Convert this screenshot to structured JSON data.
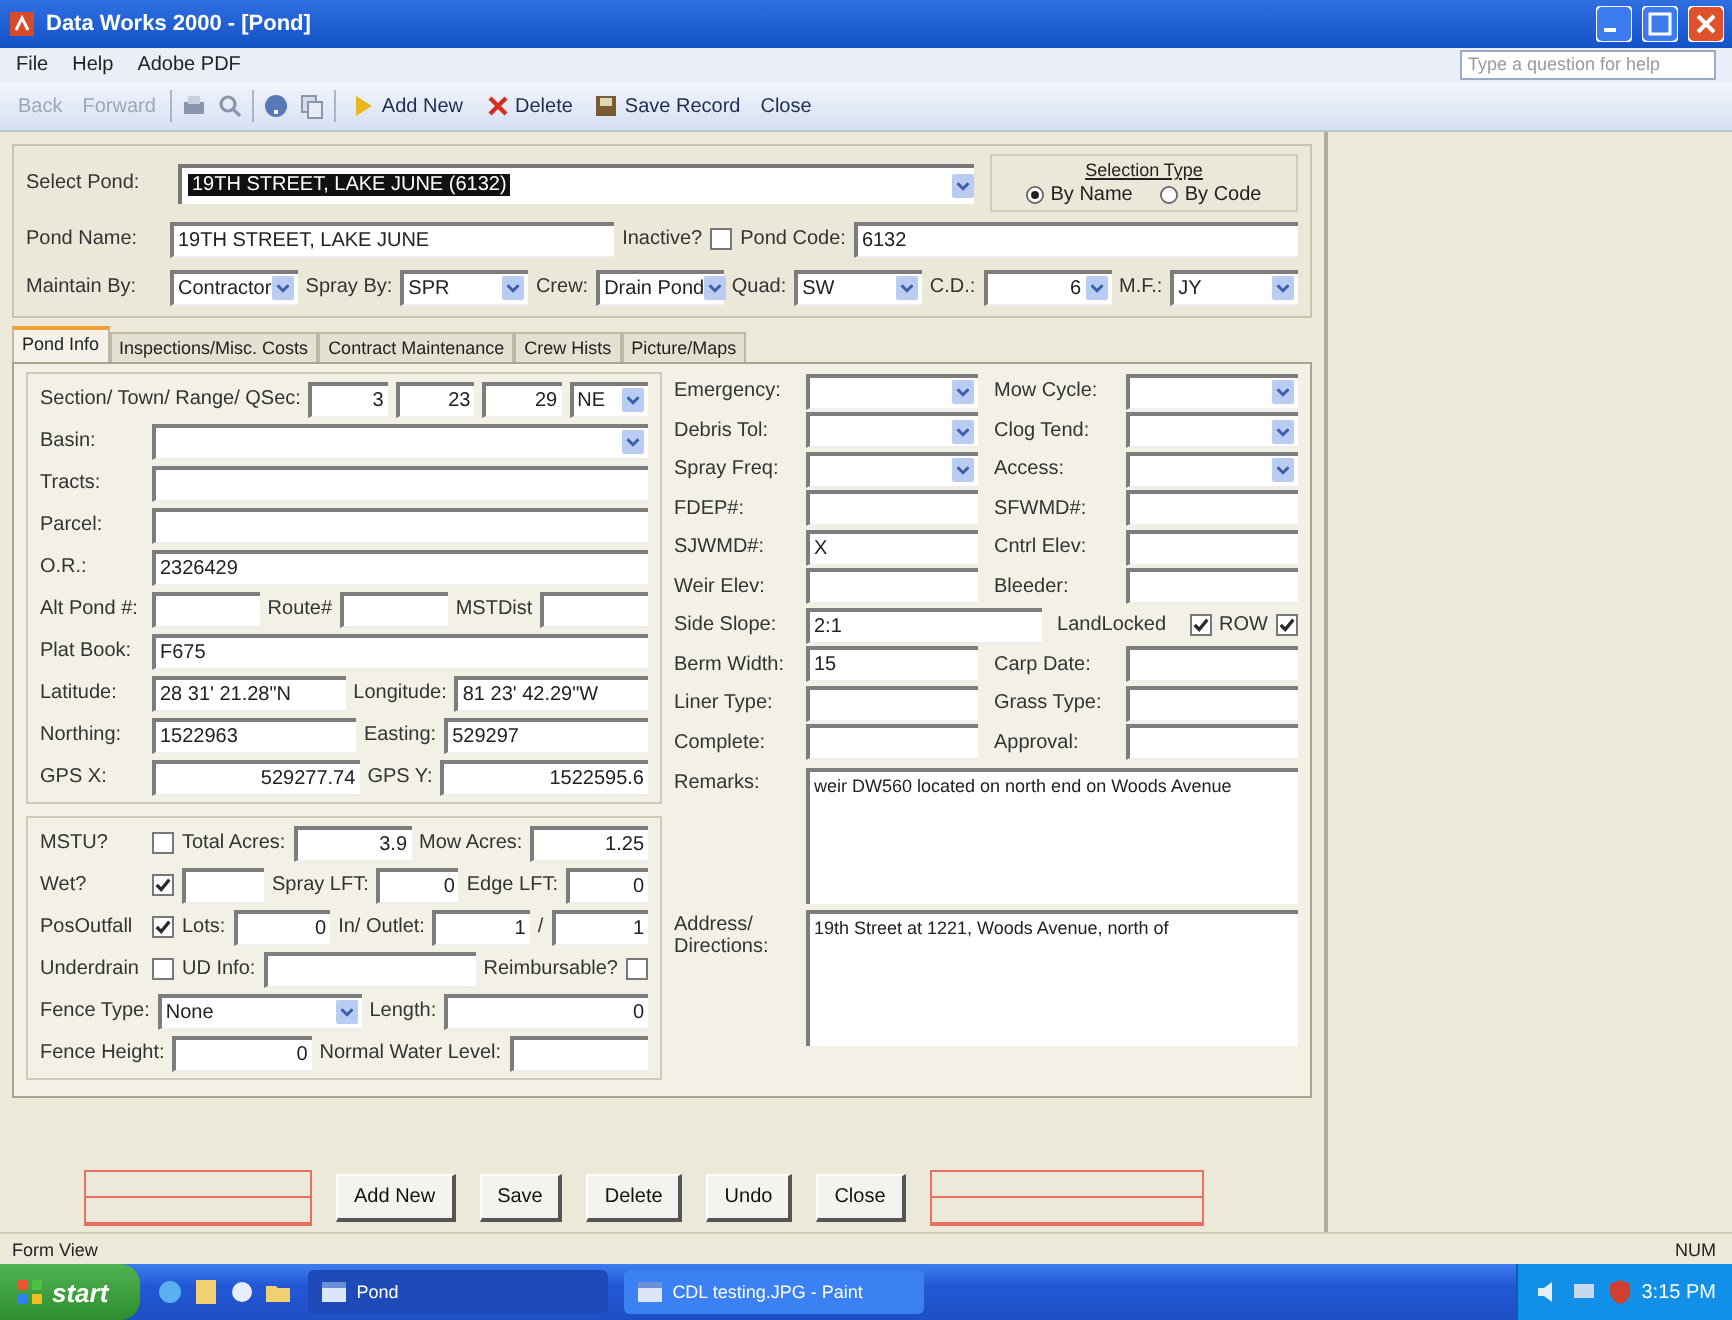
{
  "window": {
    "title": "Data Works 2000 - [Pond]"
  },
  "menu": {
    "items": [
      "File",
      "Help",
      "Adobe PDF"
    ],
    "help_box": {
      "placeholder": "Type a question for help"
    }
  },
  "toolbar": {
    "nav": [
      {
        "label": "Back",
        "disabled": true
      },
      {
        "label": "Forward",
        "disabled": true
      }
    ],
    "actions": [
      {
        "label": "Add New",
        "kind": "add"
      },
      {
        "label": "Delete",
        "kind": "delete"
      },
      {
        "label": "Save Record",
        "kind": "save"
      },
      {
        "label": "Close",
        "kind": "plain"
      }
    ]
  },
  "header": {
    "select_pond": {
      "label": "Select Pond:",
      "value": "19TH STREET, LAKE JUNE (6132)"
    },
    "selection_type": {
      "title": "Selection Type",
      "options": [
        {
          "label": "By Name",
          "selected": true
        },
        {
          "label": "By Code",
          "selected": false
        }
      ]
    },
    "pond_row": [
      {
        "kind": "label",
        "text": "Pond Name:"
      },
      {
        "kind": "text",
        "value": "19TH STREET, LAKE JUNE"
      },
      {
        "kind": "label",
        "text": "Inactive?"
      },
      {
        "kind": "check",
        "checked": false
      },
      {
        "kind": "label",
        "text": "Pond Code:"
      },
      {
        "kind": "text",
        "value": "6132"
      }
    ],
    "maintain_row": [
      {
        "kind": "label",
        "text": "Maintain By:"
      },
      {
        "kind": "combo",
        "value": "Contractor"
      },
      {
        "kind": "label",
        "text": "Spray By:"
      },
      {
        "kind": "combo",
        "value": "SPR"
      },
      {
        "kind": "label",
        "text": "Crew:"
      },
      {
        "kind": "combo",
        "value": "Drain Pond"
      },
      {
        "kind": "label",
        "text": "Quad:"
      },
      {
        "kind": "combo",
        "value": "SW"
      },
      {
        "kind": "label",
        "text": "C.D.:"
      },
      {
        "kind": "numcombo",
        "value": "6"
      },
      {
        "kind": "label",
        "text": "M.F.:"
      },
      {
        "kind": "combo",
        "value": "JY"
      }
    ]
  },
  "tabs": [
    {
      "label": "Pond Info",
      "selected": true
    },
    {
      "label": "Inspections/Misc. Costs",
      "selected": false
    },
    {
      "label": "Contract Maintenance",
      "selected": false
    },
    {
      "label": "Crew Hists",
      "selected": false
    },
    {
      "label": "Picture/Maps",
      "selected": false
    }
  ],
  "location": [
    [
      {
        "kind": "label",
        "text": "Section/ Town/ Range/ QSec:"
      },
      {
        "kind": "num",
        "value": "3"
      },
      {
        "kind": "num",
        "value": "23"
      },
      {
        "kind": "num",
        "value": "29"
      },
      {
        "kind": "combo",
        "value": "NE"
      }
    ],
    [
      {
        "kind": "label",
        "text": "Basin:"
      },
      {
        "kind": "combo"
      }
    ],
    [
      {
        "kind": "label",
        "text": "Tracts:"
      },
      {
        "kind": "text"
      }
    ],
    [
      {
        "kind": "label",
        "text": "Parcel:"
      },
      {
        "kind": "text"
      }
    ],
    [
      {
        "kind": "label",
        "text": "O.R.:"
      },
      {
        "kind": "text",
        "value": "2326429"
      }
    ],
    [
      {
        "kind": "label",
        "text": "Alt Pond #:"
      },
      {
        "kind": "text"
      },
      {
        "kind": "label",
        "text": "Route#"
      },
      {
        "kind": "text"
      },
      {
        "kind": "label",
        "text": "MSTDist"
      },
      {
        "kind": "text"
      }
    ],
    [
      {
        "kind": "label",
        "text": "Plat Book:"
      },
      {
        "kind": "text",
        "value": "F675"
      }
    ],
    [
      {
        "kind": "label",
        "text": "Latitude:"
      },
      {
        "kind": "text",
        "value": "28 31' 21.28\"N"
      },
      {
        "kind": "label",
        "text": "Longitude:"
      },
      {
        "kind": "text",
        "value": "81 23' 42.29\"W"
      }
    ],
    [
      {
        "kind": "label",
        "text": "Northing:"
      },
      {
        "kind": "text",
        "value": "1522963"
      },
      {
        "kind": "label",
        "text": "Easting:"
      },
      {
        "kind": "text",
        "value": "529297"
      }
    ],
    [
      {
        "kind": "label",
        "text": "GPS X:"
      },
      {
        "kind": "num",
        "value": "529277.74"
      },
      {
        "kind": "label",
        "text": "GPS Y:"
      },
      {
        "kind": "num",
        "value": "1522595.6"
      }
    ]
  ],
  "details": [
    [
      {
        "kind": "label",
        "text": "MSTU?"
      },
      {
        "kind": "check",
        "checked": false
      },
      {
        "kind": "label",
        "text": "Total Acres:"
      },
      {
        "kind": "num",
        "value": "3.9"
      },
      {
        "kind": "label",
        "text": "Mow Acres:"
      },
      {
        "kind": "num",
        "value": "1.25"
      }
    ],
    [
      {
        "kind": "label",
        "text": "Wet?"
      },
      {
        "kind": "check",
        "checked": true
      },
      {
        "kind": "text"
      },
      {
        "kind": "label",
        "text": "Spray LFT:"
      },
      {
        "kind": "num",
        "value": "0"
      },
      {
        "kind": "label",
        "text": "Edge LFT:"
      },
      {
        "kind": "num",
        "value": "0"
      }
    ],
    [
      {
        "kind": "label",
        "text": "PosOutfall"
      },
      {
        "kind": "check",
        "checked": true
      },
      {
        "kind": "label",
        "text": "Lots:"
      },
      {
        "kind": "num",
        "value": "0"
      },
      {
        "kind": "label",
        "text": "In/ Outlet:"
      },
      {
        "kind": "num",
        "value": "1"
      },
      {
        "kind": "label",
        "text": "/"
      },
      {
        "kind": "num",
        "value": "1"
      }
    ],
    [
      {
        "kind": "label",
        "text": "Underdrain"
      },
      {
        "kind": "check",
        "checked": false
      },
      {
        "kind": "label",
        "text": "UD Info:"
      },
      {
        "kind": "text"
      },
      {
        "kind": "label",
        "text": "Reimbursable?"
      },
      {
        "kind": "check",
        "checked": false
      }
    ],
    [
      {
        "kind": "label",
        "text": "Fence Type:"
      },
      {
        "kind": "combo",
        "value": "None"
      },
      {
        "kind": "label",
        "text": "Length:"
      },
      {
        "kind": "num",
        "value": "0"
      }
    ],
    [
      {
        "kind": "label",
        "text": "Fence Height:"
      },
      {
        "kind": "num",
        "value": "0"
      },
      {
        "kind": "label",
        "text": "Normal Water Level:"
      },
      {
        "kind": "text"
      }
    ]
  ],
  "maintenance": [
    [
      {
        "kind": "label",
        "text": "Emergency:"
      },
      {
        "kind": "combo"
      },
      {
        "kind": "label",
        "text": "Mow Cycle:"
      },
      {
        "kind": "combo"
      }
    ],
    [
      {
        "kind": "label",
        "text": "Debris Tol:"
      },
      {
        "kind": "combo"
      },
      {
        "kind": "label",
        "text": "Clog Tend:"
      },
      {
        "kind": "combo"
      }
    ],
    [
      {
        "kind": "label",
        "text": "Spray Freq:"
      },
      {
        "kind": "combo"
      },
      {
        "kind": "label",
        "text": "Access:"
      },
      {
        "kind": "combo"
      }
    ],
    [
      {
        "kind": "label",
        "text": "FDEP#:"
      },
      {
        "kind": "text"
      },
      {
        "kind": "label",
        "text": "SFWMD#:"
      },
      {
        "kind": "text"
      }
    ],
    [
      {
        "kind": "label",
        "text": "SJWMD#:"
      },
      {
        "kind": "text",
        "value": "X"
      },
      {
        "kind": "label",
        "text": "Cntrl Elev:"
      },
      {
        "kind": "text"
      }
    ],
    [
      {
        "kind": "label",
        "text": "Weir Elev:"
      },
      {
        "kind": "text"
      },
      {
        "kind": "label",
        "text": "Bleeder:"
      },
      {
        "kind": "text"
      }
    ],
    [
      {
        "kind": "label",
        "text": "Side Slope:"
      },
      {
        "kind": "text",
        "value": "2:1"
      },
      {
        "kind": "label",
        "text": "LandLocked"
      },
      {
        "kind": "check",
        "checked": true
      },
      {
        "kind": "label",
        "text": "ROW"
      },
      {
        "kind": "check",
        "checked": true
      }
    ],
    [
      {
        "kind": "label",
        "text": "Berm Width:"
      },
      {
        "kind": "text",
        "value": "15"
      },
      {
        "kind": "label",
        "text": "Carp Date:"
      },
      {
        "kind": "text"
      }
    ],
    [
      {
        "kind": "label",
        "text": "Liner Type:"
      },
      {
        "kind": "text"
      },
      {
        "kind": "label",
        "text": "Grass Type:"
      },
      {
        "kind": "text"
      }
    ],
    [
      {
        "kind": "label",
        "text": "Complete:"
      },
      {
        "kind": "text"
      },
      {
        "kind": "label",
        "text": "Approval:"
      },
      {
        "kind": "text"
      }
    ]
  ],
  "notes": [
    {
      "label": "Remarks:",
      "value": "weir DW560 located on north end on Woods Avenue"
    },
    {
      "label": "Address/ Directions:",
      "value": "19th Street at 1221, Woods Avenue, north of"
    }
  ],
  "buttons": [
    "Add New",
    "Save",
    "Delete",
    "Undo",
    "Close"
  ],
  "status_bar": {
    "left": "Form View",
    "right": "NUM"
  },
  "taskbar": {
    "start": "start",
    "tasks": [
      {
        "label": "Pond",
        "selected": true
      },
      {
        "label": "CDL testing.JPG - Paint",
        "selected": false
      }
    ],
    "clock": "3:15 PM"
  }
}
